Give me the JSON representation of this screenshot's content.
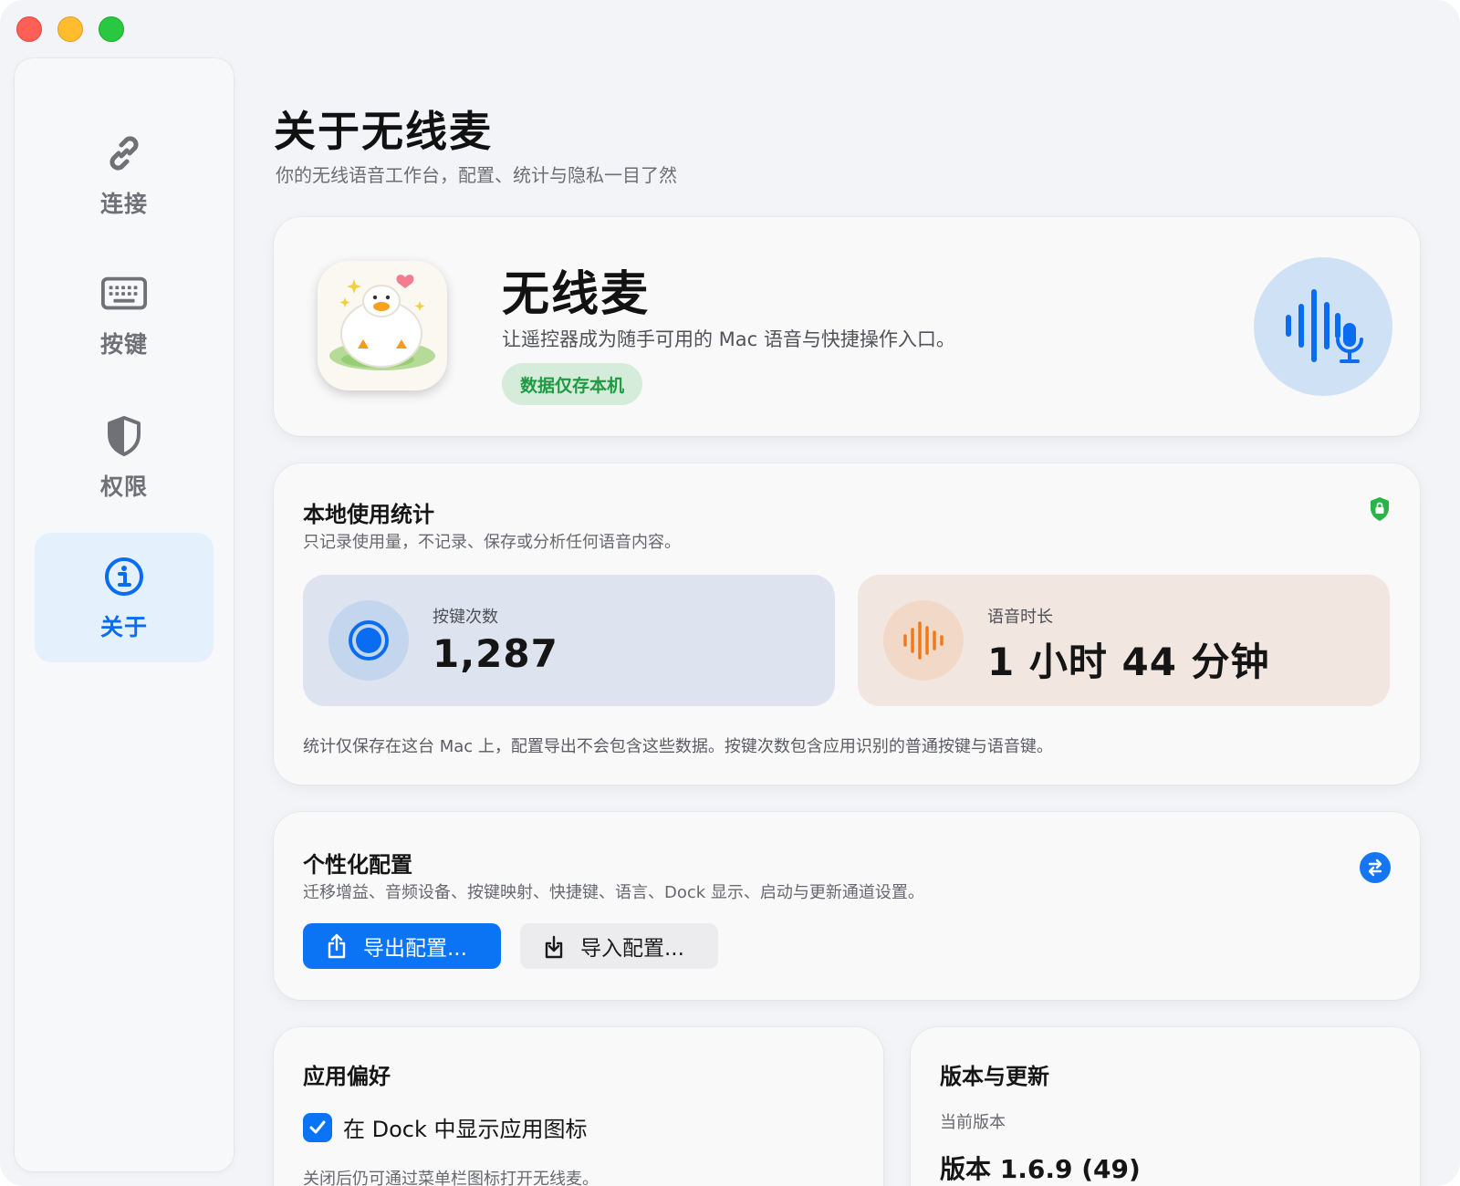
{
  "sidebar": {
    "items": [
      {
        "label": "连接",
        "icon": "link-icon"
      },
      {
        "label": "按键",
        "icon": "keyboard-icon"
      },
      {
        "label": "权限",
        "icon": "shield-icon"
      },
      {
        "label": "关于",
        "icon": "info-icon",
        "active": true
      }
    ]
  },
  "page": {
    "title": "关于无线麦",
    "subtitle": "你的无线语音工作台，配置、统计与隐私一目了然"
  },
  "hero": {
    "app_name": "无线麦",
    "tagline": "让遥控器成为随手可用的 Mac 语音与快捷操作入口。",
    "badge": "数据仅存本机",
    "icon": "duck-app-icon",
    "accent_icon": "waveform-mic-icon"
  },
  "stats": {
    "title": "本地使用统计",
    "description": "只记录使用量，不记录、保存或分析任何语音内容。",
    "key_presses": {
      "label": "按键次数",
      "value": "1,287"
    },
    "voice_duration": {
      "label": "语音时长",
      "value": "1 小时 44 分钟"
    },
    "footnote": "统计仅保存在这台 Mac 上，配置导出不会包含这些数据。按键次数包含应用识别的普通按键与语音键。"
  },
  "config": {
    "title": "个性化配置",
    "description": "迁移增益、音频设备、按键映射、快捷键、语言、Dock 显示、启动与更新通道设置。",
    "export_label": "导出配置...",
    "import_label": "导入配置..."
  },
  "prefs": {
    "title": "应用偏好",
    "dock_checkbox_label": "在 Dock 中显示应用图标",
    "dock_checked": true,
    "dock_hint": "关闭后仍可通过菜单栏图标打开无线麦。"
  },
  "version": {
    "title": "版本与更新",
    "current_label": "当前版本",
    "current_value": "版本 1.6.9 (49)"
  },
  "colors": {
    "accent": "#0a74f5",
    "green": "#1f9a43",
    "orange": "#f07a1a"
  }
}
